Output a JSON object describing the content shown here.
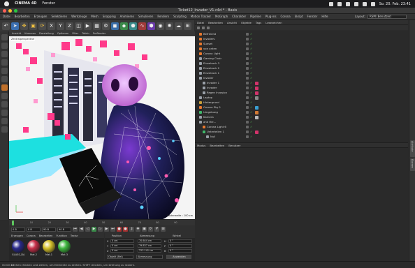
{
  "menubar": {
    "app": "CINEMA 4D",
    "items": [
      "Fenster"
    ],
    "datetime": "So. 20. Feb.  23:41"
  },
  "window": {
    "title": "Ticket12_Invader_V1.c4d * - Basis"
  },
  "appmenu": {
    "items": [
      "Datei",
      "Bearbeiten",
      "Erzeugen",
      "Selektieren",
      "Werkzeuge",
      "Mesh",
      "Snapping",
      "Animieren",
      "Simulieren",
      "Rendern",
      "Sculpting",
      "Motion Tracker",
      "MoGraph",
      "Charakter",
      "Pipeline",
      "Plug-ins",
      "Corona",
      "Skript",
      "Fenster",
      "Hilfe"
    ],
    "layout_label": "Layout:",
    "layout_value": "RSM (Benutzer)"
  },
  "viewport": {
    "menu": [
      "Ansicht",
      "Kameras",
      "Darstellung",
      "Optionen",
      "Filter",
      "Tafeln",
      "ProRender"
    ],
    "camera_label": "Zentralperspektive",
    "grid_label": "Rasterweite : 100 cm"
  },
  "object_manager": {
    "tabs": [
      "Datei",
      "Bearbeiten",
      "Ansicht",
      "Objekte",
      "Tags",
      "Lesezeichen"
    ],
    "rows": [
      {
        "name": "Befreiend",
        "indent": 0,
        "color": "#e8782e",
        "tag": ""
      },
      {
        "name": "Invaders",
        "indent": 0,
        "color": "#e8782e",
        "tag": ""
      },
      {
        "name": "Sunset",
        "indent": 0,
        "color": "#e8782e",
        "tag": ""
      },
      {
        "name": "von unten",
        "indent": 0,
        "color": "#e8782e",
        "tag": ""
      },
      {
        "name": "Corona Light",
        "indent": 0,
        "color": "#e8782e",
        "tag": ""
      },
      {
        "name": "Gaming Chair",
        "indent": 0,
        "color": "#9aa0a8",
        "tag": ""
      },
      {
        "name": "Einzelrack 3",
        "indent": 0,
        "color": "#9aa0a8",
        "tag": ""
      },
      {
        "name": "Einzelrack 2",
        "indent": 0,
        "color": "#9aa0a8",
        "tag": ""
      },
      {
        "name": "Einzelrack 1",
        "indent": 0,
        "color": "#9aa0a8",
        "tag": ""
      },
      {
        "name": "Invader",
        "indent": 0,
        "color": "#9aa0a8",
        "tag": ""
      },
      {
        "name": "Invader 1",
        "indent": 1,
        "color": "#9aa0a8",
        "tag": "#d2336a"
      },
      {
        "name": "Invader",
        "indent": 1,
        "color": "#9aa0a8",
        "tag": "#d2336a"
      },
      {
        "name": "Regen Invasion",
        "indent": 1,
        "color": "#9aa0a8",
        "tag": "#d2336a"
      },
      {
        "name": "Laptop",
        "indent": 0,
        "color": "#9aa0a8",
        "tag": "#8a8a8a"
      },
      {
        "name": "Hintergrund",
        "indent": 0,
        "color": "#c7a03a",
        "tag": ""
      },
      {
        "name": "Corona Sky 1",
        "indent": 0,
        "color": "#e8782e",
        "tag": "#3aa0d2"
      },
      {
        "name": "Umgebung",
        "indent": 0,
        "color": "#3fb86a",
        "tag": "#d27a33"
      },
      {
        "name": "Kamera",
        "indent": 0,
        "color": "#9aa0a8",
        "tag": "#bbbbbb"
      },
      {
        "name": "and the...",
        "indent": 0,
        "color": "#9aa0a8",
        "tag": ""
      },
      {
        "name": "Corona Light 6",
        "indent": 1,
        "color": "#e8782e",
        "tag": ""
      },
      {
        "name": "Unterteilen 1",
        "indent": 1,
        "color": "#3fb86a",
        "tag": "#d2336a"
      },
      {
        "name": "Null",
        "indent": 2,
        "color": "#9aa0a8",
        "tag": ""
      }
    ]
  },
  "attribute_manager": {
    "tabs": [
      "Modus",
      "Bearbeiten",
      "Benutzer"
    ]
  },
  "right_strip": {
    "tabs": [
      "Attribute",
      "Ebenen"
    ]
  },
  "timeline": {
    "ticks": [
      "0",
      "10",
      "20",
      "30",
      "40",
      "50",
      "60",
      "70",
      "80",
      "90"
    ],
    "start": "0 B",
    "end": "90 B",
    "current": "0 B",
    "end_field": "90 B"
  },
  "material_manager": {
    "tabs": [
      "Erzeugen",
      "Corona",
      "Bearbeiten",
      "Funktion",
      "Textur"
    ],
    "materials": [
      {
        "name": "GLASS_DA",
        "color": "#2a2a8a"
      },
      {
        "name": "Mat.2",
        "color": "#c7304a"
      },
      {
        "name": "Mat.1",
        "color": "#d4c02a"
      },
      {
        "name": "Mat.3",
        "color": "#3fb83f"
      }
    ]
  },
  "coordinates": {
    "tabs": [
      "Position",
      "Abmessung",
      "Winkel"
    ],
    "rows": [
      {
        "axis": "X",
        "pos": "0 cm",
        "size": "70.644 cm",
        "rot_axis": "H",
        "rot": "0 °"
      },
      {
        "axis": "Y",
        "pos": "0 cm",
        "size": "79.837 cm",
        "rot_axis": "P",
        "rot": "0 °"
      },
      {
        "axis": "Z",
        "pos": "0 cm",
        "size": "222.141 cm",
        "rot_axis": "B",
        "rot": "0 °"
      }
    ],
    "mode_left": "Objekt (Rel)",
    "mode_mid": "Abmessung",
    "apply": "Anwenden"
  },
  "statusbar": {
    "time": "00:00:13",
    "message": "Drehen: Klicken und ziehen, um Elemente zu drehen. SHIFT drücken, um Drehung zu rastern."
  }
}
